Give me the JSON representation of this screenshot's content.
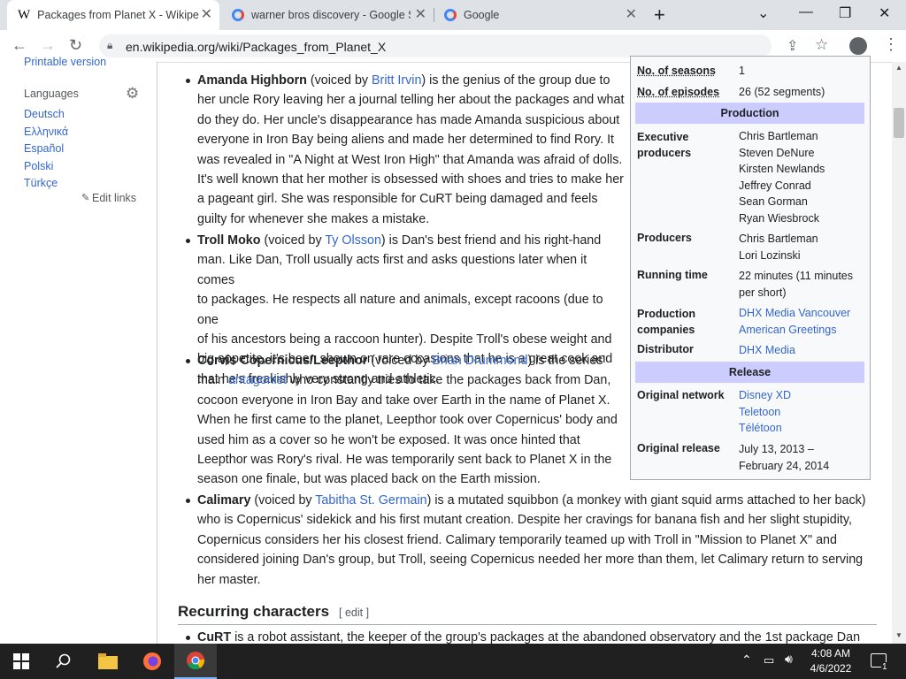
{
  "browser": {
    "tabs": [
      {
        "label": "Packages from Planet X - Wikipe",
        "favicon": "W",
        "active": true
      },
      {
        "label": "warner bros discovery - Google S",
        "favicon": "G",
        "active": false
      },
      {
        "label": "Google",
        "favicon": "G",
        "active": false
      }
    ],
    "new_tab": "+",
    "url": "en.wikipedia.org/wiki/Packages_from_Planet_X"
  },
  "sidebar": {
    "printable": "Printable version",
    "languages_title": "Languages",
    "languages": [
      "Deutsch",
      "Ελληνικά",
      "Español",
      "Polski",
      "Türkçe"
    ],
    "edit_links": "Edit links"
  },
  "article": {
    "characters": [
      {
        "name": "Amanda Highborn",
        "voiced_by_prefix": " (voiced by ",
        "actor": "Britt Irvin",
        "lines": [
          ") is the genius of the group due to",
          "her uncle Rory leaving her a journal telling her about the packages and what",
          "do they do. Her uncle's disappearance has made Amanda suspicious about",
          "everyone in Iron Bay being aliens and made her determined to find Rory. It",
          "was revealed in \"A Night at West Iron High\" that Amanda was afraid of dolls.",
          "It's well known that her mother is obsessed with shoes and tries to make her",
          "a pageant girl. She was responsible for CuRT being damaged and feels",
          "guilty for whenever she makes a mistake."
        ]
      },
      {
        "name": "Troll Moko",
        "voiced_by_prefix": " (voiced by ",
        "actor": "Ty Olsson",
        "lines": [
          ") is Dan's best friend and his right-hand",
          "man. Like Dan, Troll usually acts first and asks questions later when it comes",
          "to packages. He respects all nature and animals, except racoons (due to one",
          "of his ancestors being a raccoon hunter). Despite Troll's obese weight and",
          "big appetite, it's been shown on rare occasions that he is a great cook and",
          "that he's freakishly very strong and athletic."
        ]
      },
      {
        "name": "Corvis Copernicus/Leepthor",
        "voiced_by_prefix": " (voiced by ",
        "actor": "Brian Drummond",
        "lines": [
          ") is the series'",
          "main antagonist who constantly tries to take the packages back from Dan,",
          "cocoon everyone in Iron Bay and take over Earth in the name of Planet X.",
          "When he first came to the planet, Leepthor took over Copernicus' body and",
          "used him as a cover so he won't be exposed. It was once hinted that",
          "Leepthor was Rory's rival. He was temporarily sent back to Planet X in the",
          "season one finale, but was placed back on the Earth mission."
        ]
      },
      {
        "name": "Calimary",
        "voiced_by_prefix": " (voiced by ",
        "actor": "Tabitha St. Germain",
        "lines": [
          ") is a mutated squibbon (a monkey with giant squid arms attached to her back)",
          "who is Copernicus' sidekick and his first mutant creation. Despite her cravings for banana fish and her slight stupidity,",
          "Copernicus considers her his closest friend. Calimary temporarily teamed up with Troll in \"Mission to Planet X\" and",
          "considered joining Dan's group, but Troll, seeing Copernicus needed her more than them, let Calimary return to serving",
          "her master."
        ]
      }
    ],
    "antagonist_link": "antagonist",
    "recurring_heading": "Recurring characters",
    "edit": "[ edit ]",
    "curt_name": "CuRT",
    "curt_line": " is a robot assistant, the keeper of the group's packages at the abandoned observatory and the 1st package Dan"
  },
  "infobox": {
    "seasons_label": "No. of seasons",
    "seasons_value": "1",
    "episodes_label": "No. of episodes",
    "episodes_value": "26 (52 segments)",
    "production_header": "Production",
    "exec_label": "Executive producers",
    "exec_values": [
      "Chris Bartleman",
      "Steven DeNure",
      "Kirsten Newlands",
      "Jeffrey Conrad",
      "Sean Gorman",
      "Ryan Wiesbrock"
    ],
    "producers_label": "Producers",
    "producers_values": [
      "Chris Bartleman",
      "Lori Lozinski"
    ],
    "runtime_label": "Running time",
    "runtime_value": [
      "22 minutes (11 minutes",
      "per short)"
    ],
    "companies_label": "Production companies",
    "companies_values": [
      "DHX Media Vancouver",
      "American Greetings"
    ],
    "distributor_label": "Distributor",
    "distributor_value": "DHX Media",
    "release_header": "Release",
    "network_label": "Original network",
    "network_values": [
      "Disney XD",
      "Teletoon",
      "Télétoon"
    ],
    "release_label": "Original release",
    "release_value": [
      "July 13, 2013 –",
      "February 24, 2014"
    ]
  },
  "taskbar": {
    "time": "4:08 AM",
    "date": "4/6/2022",
    "notification_count": "1"
  },
  "colors": {
    "link": "#3366cc",
    "header_bg": "#ccccff",
    "taskbar": "#202020"
  }
}
